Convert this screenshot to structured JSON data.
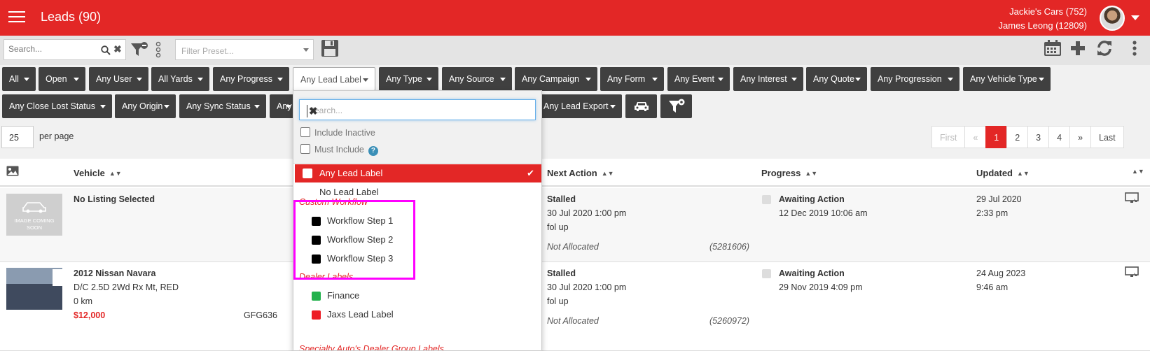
{
  "header": {
    "title": "Leads (90)",
    "account_line1": "Jackie's Cars (752)",
    "account_line2": "James Leong (12809)"
  },
  "toolbar": {
    "search_placeholder": "Search...",
    "preset_placeholder": "Filter Preset..."
  },
  "filters": {
    "row1": [
      "All",
      "Open",
      "Any User",
      "All Yards",
      "Any Progress",
      "Any Lead Label",
      "Any Type",
      "Any Source",
      "Any Campaign",
      "Any Form",
      "Any Event",
      "Any Interest",
      "Any Quote",
      "Any Progression",
      "Any Vehicle Type"
    ],
    "row2": [
      "Any Close Lost Status",
      "Any Origin",
      "Any Sync Status",
      "Any",
      "Any Lead Export"
    ]
  },
  "perpage": {
    "value": "25",
    "label": "per page"
  },
  "pagination": [
    "First",
    "«",
    "1",
    "2",
    "3",
    "4",
    "»",
    "Last"
  ],
  "table": {
    "headers": {
      "vehicle": "Vehicle",
      "next_action": "Next Action",
      "progress": "Progress",
      "updated": "Updated"
    },
    "rows": [
      {
        "thumb_text": "IMAGE COMING SOON",
        "vehicle": "No Listing Selected",
        "next_status": "Stalled",
        "next_date": "30 Jul 2020 1:00 pm",
        "next_note": "fol up",
        "allocated": "Not Allocated",
        "lead_id": "(5281606)",
        "progress_status": "Awaiting Action",
        "progress_date": "12 Dec 2019 10:06 am",
        "updated_date": "29 Jul 2020",
        "updated_time": "2:33 pm"
      },
      {
        "vehicle": "2012 Nissan Navara",
        "vehicle_detail": "D/C 2.5D 2Wd Rx Mt, RED",
        "km": "0 km",
        "price": "$12,000",
        "stock": "GFG636",
        "next_status": "Stalled",
        "next_date": "30 Jul 2020 1:00 pm",
        "next_note": "fol up",
        "allocated": "Not Allocated",
        "lead_id": "(5260972)",
        "progress_status": "Awaiting Action",
        "progress_date": "29 Nov 2019 4:09 pm",
        "updated_date": "24 Aug 2023",
        "updated_time": "9:46 am"
      }
    ]
  },
  "dropdown": {
    "search_placeholder": "Search...",
    "include_inactive": "Include Inactive",
    "must_include": "Must Include",
    "help": "?",
    "selected": "Any Lead Label",
    "no_label": "No Lead Label",
    "groups": [
      {
        "name": "Custom Workflow",
        "items": [
          {
            "label": "Workflow Step 1",
            "color": "#000000"
          },
          {
            "label": "Workflow Step 2",
            "color": "#000000"
          },
          {
            "label": "Workflow Step 3",
            "color": "#000000"
          }
        ]
      },
      {
        "name": "Dealer Labels",
        "items": [
          {
            "label": "Finance",
            "color": "#22b14c"
          },
          {
            "label": "Jaxs Lead Label",
            "color": "#ed1c24"
          }
        ]
      },
      {
        "name": "Specialty Auto's Dealer Group Labels",
        "items": []
      }
    ]
  },
  "colors": {
    "brand": "#e32726",
    "highlight": "#ff00ff"
  }
}
